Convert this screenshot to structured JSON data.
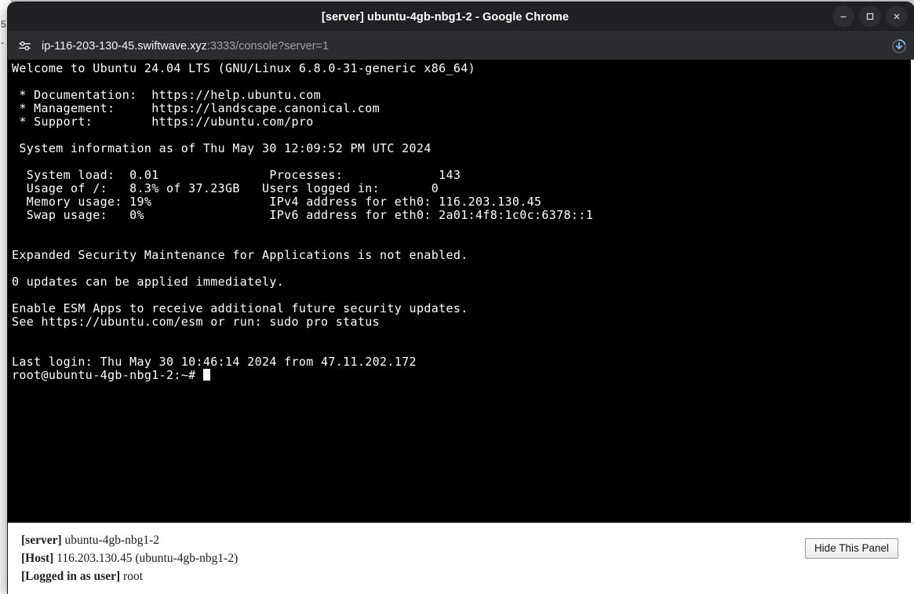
{
  "window": {
    "title": "[server] ubuntu-4gb-nbg1-2 - Google Chrome",
    "controls": {
      "minimize_name": "minimize-button",
      "maximize_name": "maximize-button",
      "close_name": "close-button"
    }
  },
  "toolbar": {
    "site_settings_icon": "tune-icon",
    "url_host": "ip-116-203-130-45.swiftwave.xyz",
    "url_path": ":3333/console?server=1",
    "download_icon": "download-icon"
  },
  "background_window": {
    "line1": "5",
    "line2": "-"
  },
  "terminal": {
    "lines": [
      "Welcome to Ubuntu 24.04 LTS (GNU/Linux 6.8.0-31-generic x86_64)",
      "",
      " * Documentation:  https://help.ubuntu.com",
      " * Management:     https://landscape.canonical.com",
      " * Support:        https://ubuntu.com/pro",
      "",
      " System information as of Thu May 30 12:09:52 PM UTC 2024",
      "",
      "  System load:  0.01               Processes:             143",
      "  Usage of /:   8.3% of 37.23GB   Users logged in:       0",
      "  Memory usage: 19%                IPv4 address for eth0: 116.203.130.45",
      "  Swap usage:   0%                 IPv6 address for eth0: 2a01:4f8:1c0c:6378::1",
      "",
      "",
      "Expanded Security Maintenance for Applications is not enabled.",
      "",
      "0 updates can be applied immediately.",
      "",
      "Enable ESM Apps to receive additional future security updates.",
      "See https://ubuntu.com/esm or run: sudo pro status",
      "",
      "",
      "Last login: Thu May 30 10:46:14 2024 from 47.11.202.172"
    ],
    "prompt": "root@ubuntu-4gb-nbg1-2:~# "
  },
  "info_panel": {
    "rows": [
      {
        "label": "[server]",
        "value": "ubuntu-4gb-nbg1-2"
      },
      {
        "label": "[Host]",
        "value": "116.203.130.45 (ubuntu-4gb-nbg1-2)"
      },
      {
        "label": "[Logged in as user]",
        "value": "root"
      }
    ],
    "hide_button_label": "Hide This Panel"
  },
  "colors": {
    "chrome_frame": "#202124",
    "toolbar": "#2b2c2f",
    "terminal_bg": "#000000",
    "terminal_fg": "#ffffff",
    "download_accent": "#8ab4f8",
    "panel_bg": "#ffffff"
  }
}
